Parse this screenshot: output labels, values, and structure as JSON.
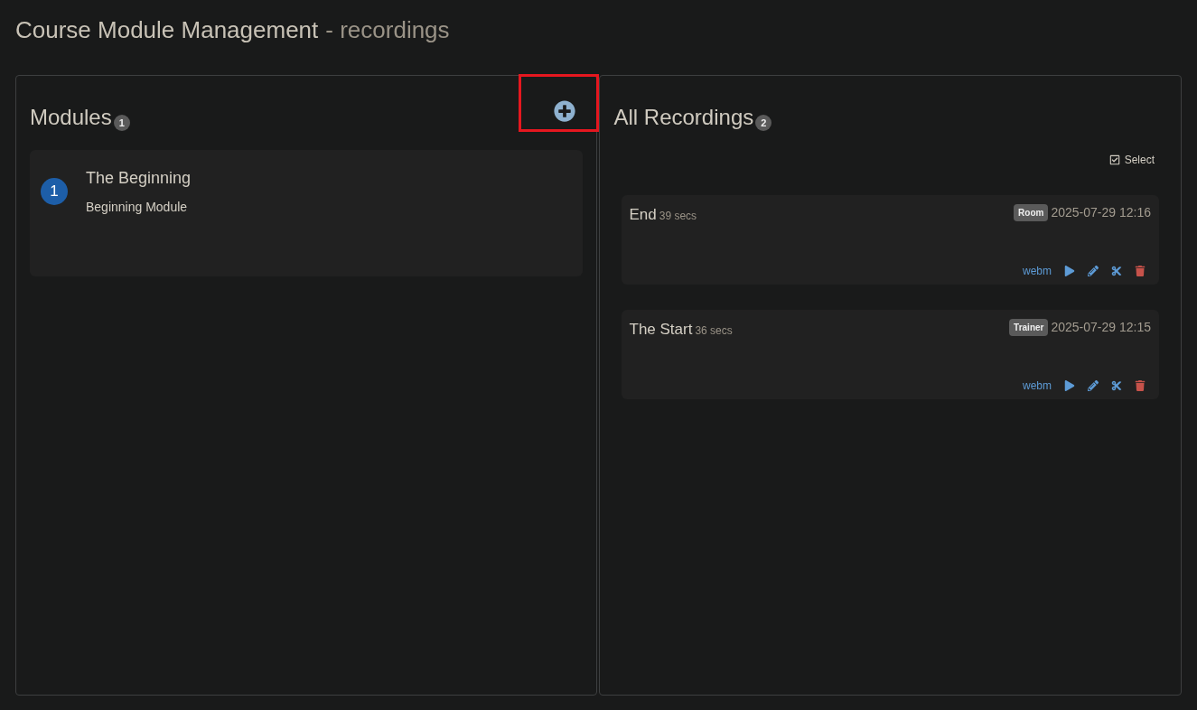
{
  "page": {
    "title": "Course Module Management",
    "subtitle": "- recordings"
  },
  "modules_panel": {
    "title": "Modules",
    "count": "1",
    "add_button": {
      "highlighted": true
    },
    "modules": [
      {
        "number": "1",
        "name": "The Beginning",
        "description": "Beginning Module"
      }
    ]
  },
  "recordings_panel": {
    "title": "All Recordings",
    "count": "2",
    "select_label": "Select",
    "recordings": [
      {
        "name": "End",
        "duration": "39 secs",
        "tag": "Room",
        "date": "2025-07-29 12:16",
        "format": "webm"
      },
      {
        "name": "The Start",
        "duration": "36 secs",
        "tag": "Trainer",
        "date": "2025-07-29 12:15",
        "format": "webm"
      }
    ]
  }
}
